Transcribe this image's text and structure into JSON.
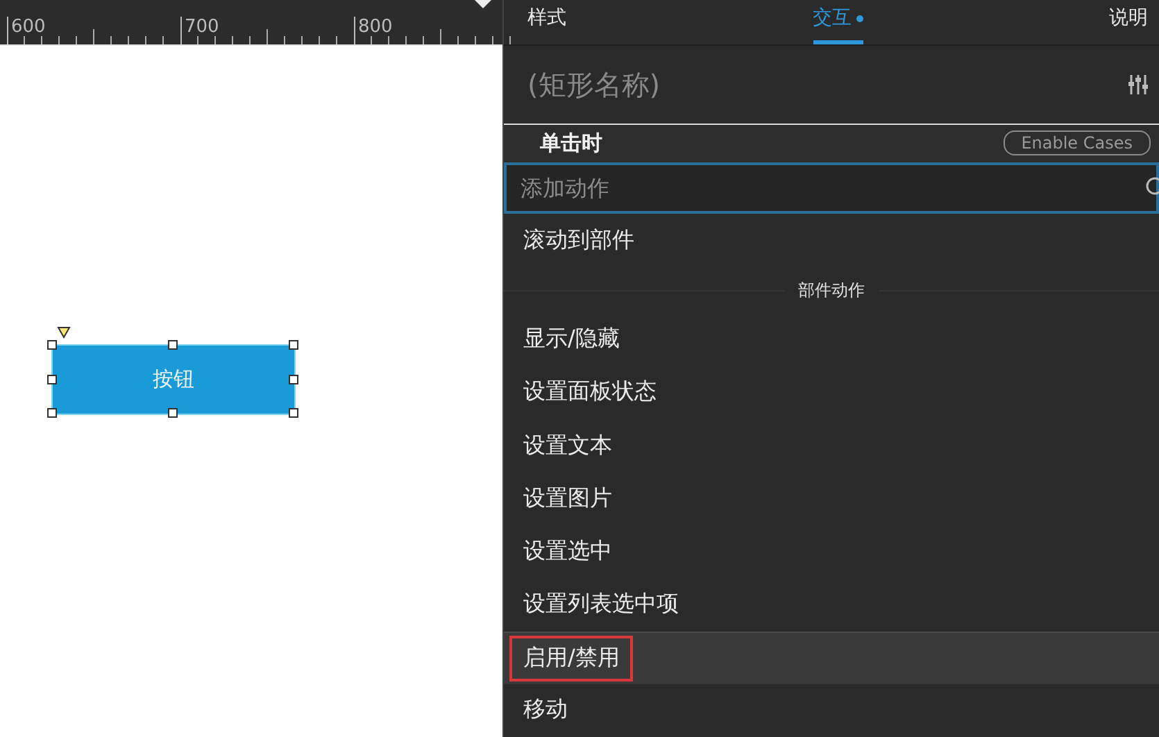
{
  "ruler": {
    "labels": [
      "600",
      "700",
      "800"
    ]
  },
  "canvas": {
    "widget": {
      "label": "按钮",
      "selected": true
    }
  },
  "panel": {
    "tabs": [
      {
        "label": "样式",
        "selected": false,
        "dot": false
      },
      {
        "label": "交互",
        "selected": true,
        "dot": true
      },
      {
        "label": "说明",
        "selected": false,
        "dot": false
      }
    ],
    "name_placeholder": "(矩形名称)",
    "event": {
      "title": "单击时",
      "button": "Enable Cases"
    },
    "search": {
      "placeholder": "添加动作"
    },
    "actions": [
      {
        "kind": "item",
        "label": "滚动到部件",
        "selected": false,
        "marked": false
      },
      {
        "kind": "section",
        "label": "部件动作"
      },
      {
        "kind": "item",
        "label": "显示/隐藏",
        "selected": false,
        "marked": false
      },
      {
        "kind": "item",
        "label": "设置面板状态",
        "selected": false,
        "marked": false
      },
      {
        "kind": "item",
        "label": "设置文本",
        "selected": false,
        "marked": false
      },
      {
        "kind": "item",
        "label": "设置图片",
        "selected": false,
        "marked": false
      },
      {
        "kind": "item",
        "label": "设置选中",
        "selected": false,
        "marked": false
      },
      {
        "kind": "item",
        "label": "设置列表选中项",
        "selected": false,
        "marked": false
      },
      {
        "kind": "item",
        "label": "启用/禁用",
        "selected": true,
        "marked": true
      },
      {
        "kind": "item",
        "label": "移动",
        "selected": false,
        "marked": false
      }
    ]
  }
}
